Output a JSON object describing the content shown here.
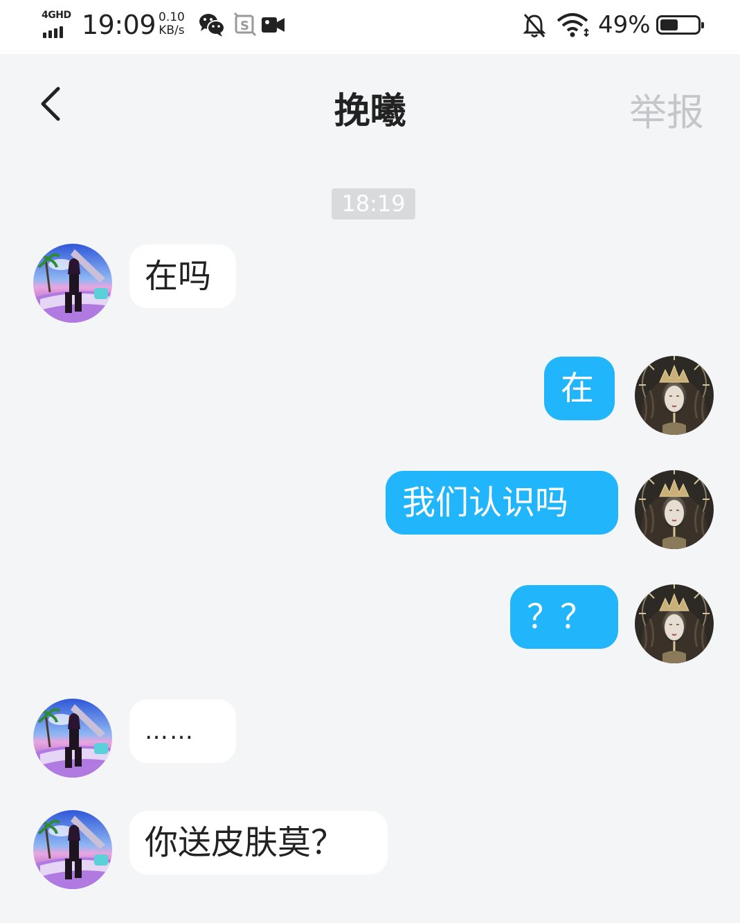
{
  "status_bar": {
    "network_type": "4GHD",
    "time": "19:09",
    "speed_value": "0.10",
    "speed_unit": "KB/s",
    "battery_percent": "49%",
    "battery_level": 0.49,
    "icons": [
      "signal-icon",
      "wechat-icon",
      "screenshot-app-icon",
      "video-camera-icon",
      "bell-muted-icon",
      "wifi-icon",
      "battery-icon"
    ]
  },
  "header": {
    "title": "挽曦",
    "report_label": "举报",
    "back_icon": "chevron-left-icon"
  },
  "chat": {
    "timestamp": "18:19",
    "messages": [
      {
        "side": "in",
        "text": "在吗"
      },
      {
        "side": "out",
        "text": "在"
      },
      {
        "side": "out",
        "text": "我们认识吗"
      },
      {
        "side": "out",
        "text": "？？"
      },
      {
        "side": "in",
        "text": "……"
      },
      {
        "side": "in",
        "text": "你送皮肤莫？"
      }
    ]
  },
  "colors": {
    "outgoing_bubble": "#21b5fb",
    "incoming_bubble": "#ffffff",
    "background": "#f4f5f7",
    "report_text": "#c4c6c9"
  }
}
